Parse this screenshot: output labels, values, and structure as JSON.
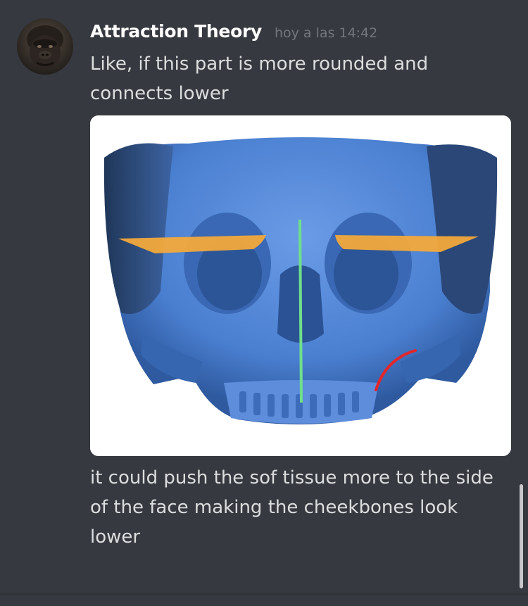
{
  "message": {
    "author": "Attraction Theory",
    "timestamp": "hoy a las 14:42",
    "text_before": "Like, if this part is more rounded and connects lower",
    "text_after": "it could push the sof tissue more to the side of the face making the cheekbones look lower",
    "avatar_icon": "gorilla-avatar-icon",
    "attachment_icon": "skull-scan-image-icon"
  },
  "colors": {
    "background": "#36393f",
    "username": "#ffffff",
    "timestamp": "#72767d",
    "message_text": "#dcddde",
    "skull": "#4a7fd0",
    "horizontal_lines": "#f2a93b",
    "midline": "#6fe08a",
    "curve_marker": "#e3262a"
  }
}
